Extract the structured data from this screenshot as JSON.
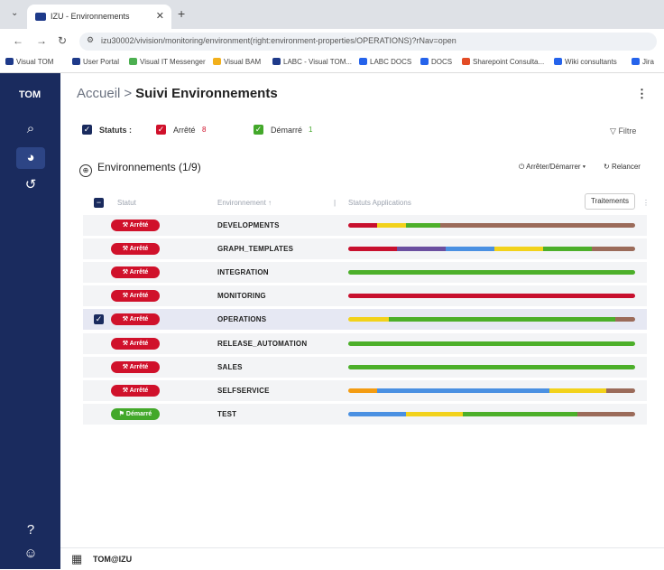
{
  "browser": {
    "tab_title": "IZU - Environnements",
    "url": "izu30002/vivision/monitoring/environment(right:environment-properties/OPERATIONS)?rNav=open",
    "bookmarks": [
      "Visual TOM",
      "User Portal",
      "Visual IT Messenger",
      "Visual BAM",
      "LABC - Visual TOM...",
      "LABC DOCS",
      "DOCS",
      "Sharepoint Consulta...",
      "Wiki consultants",
      "Jira"
    ]
  },
  "sidebar": {
    "logo": "TOM"
  },
  "breadcrumb": {
    "home": "Accueil",
    "separator": ">",
    "current": "Suivi Environnements"
  },
  "status_filter": {
    "label": "Statuts :",
    "stopped": {
      "label": "Arrêté",
      "count": "8"
    },
    "started": {
      "label": "Démarré",
      "count": "1"
    },
    "filter_label": "Filtre"
  },
  "environments": {
    "title": "Environnements (1/9)",
    "start_stop_label": "Arrêter/Démarrer",
    "restart_label": "Relancer",
    "columns": {
      "status": "Statut",
      "environment": "Environnement",
      "apps_status": "Statuts Applications",
      "treatments": "Traitements"
    },
    "rows": [
      {
        "status": "Arrêté",
        "name": "DEVELOPMENTS",
        "selected": false
      },
      {
        "status": "Arrêté",
        "name": "GRAPH_TEMPLATES",
        "selected": false
      },
      {
        "status": "Arrêté",
        "name": "INTEGRATION",
        "selected": false
      },
      {
        "status": "Arrêté",
        "name": "MONITORING",
        "selected": false
      },
      {
        "status": "Arrêté",
        "name": "OPERATIONS",
        "selected": true
      },
      {
        "status": "Arrêté",
        "name": "RELEASE_AUTOMATION",
        "selected": false
      },
      {
        "status": "Arrêté",
        "name": "SALES",
        "selected": false
      },
      {
        "status": "Arrêté",
        "name": "SELFSERVICE",
        "selected": false
      },
      {
        "status": "Démarré",
        "name": "TEST",
        "selected": false
      }
    ],
    "bar_segments": [
      [
        [
          "#c8102e",
          0.1
        ],
        [
          "#f2d21b",
          0.1
        ],
        [
          "#4caf2a",
          0.12
        ],
        [
          "#9b6b5a",
          0.68
        ]
      ],
      [
        [
          "#c8102e",
          0.17
        ],
        [
          "#6b4fa0",
          0.17
        ],
        [
          "#4a90e2",
          0.17
        ],
        [
          "#f2d21b",
          0.17
        ],
        [
          "#4caf2a",
          0.17
        ],
        [
          "#9b6b5a",
          0.15
        ]
      ],
      [
        [
          "#4caf2a",
          1.0
        ]
      ],
      [
        [
          "#c8102e",
          1.0
        ]
      ],
      [
        [
          "#f2d21b",
          0.14
        ],
        [
          "#4caf2a",
          0.79
        ],
        [
          "#9b6b5a",
          0.07
        ]
      ],
      [
        [
          "#4caf2a",
          1.0
        ]
      ],
      [
        [
          "#4caf2a",
          1.0
        ]
      ],
      [
        [
          "#f39c12",
          0.1
        ],
        [
          "#4a90e2",
          0.6
        ],
        [
          "#f2d21b",
          0.2
        ],
        [
          "#9b6b5a",
          0.1
        ]
      ],
      [
        [
          "#4a90e2",
          0.2
        ],
        [
          "#f2d21b",
          0.2
        ],
        [
          "#4caf2a",
          0.4
        ],
        [
          "#9b6b5a",
          0.2
        ]
      ]
    ]
  },
  "status_colors": {
    "stopped": "#d0112b",
    "started": "#43a82a"
  },
  "footer": {
    "user": "TOM@IZU"
  }
}
